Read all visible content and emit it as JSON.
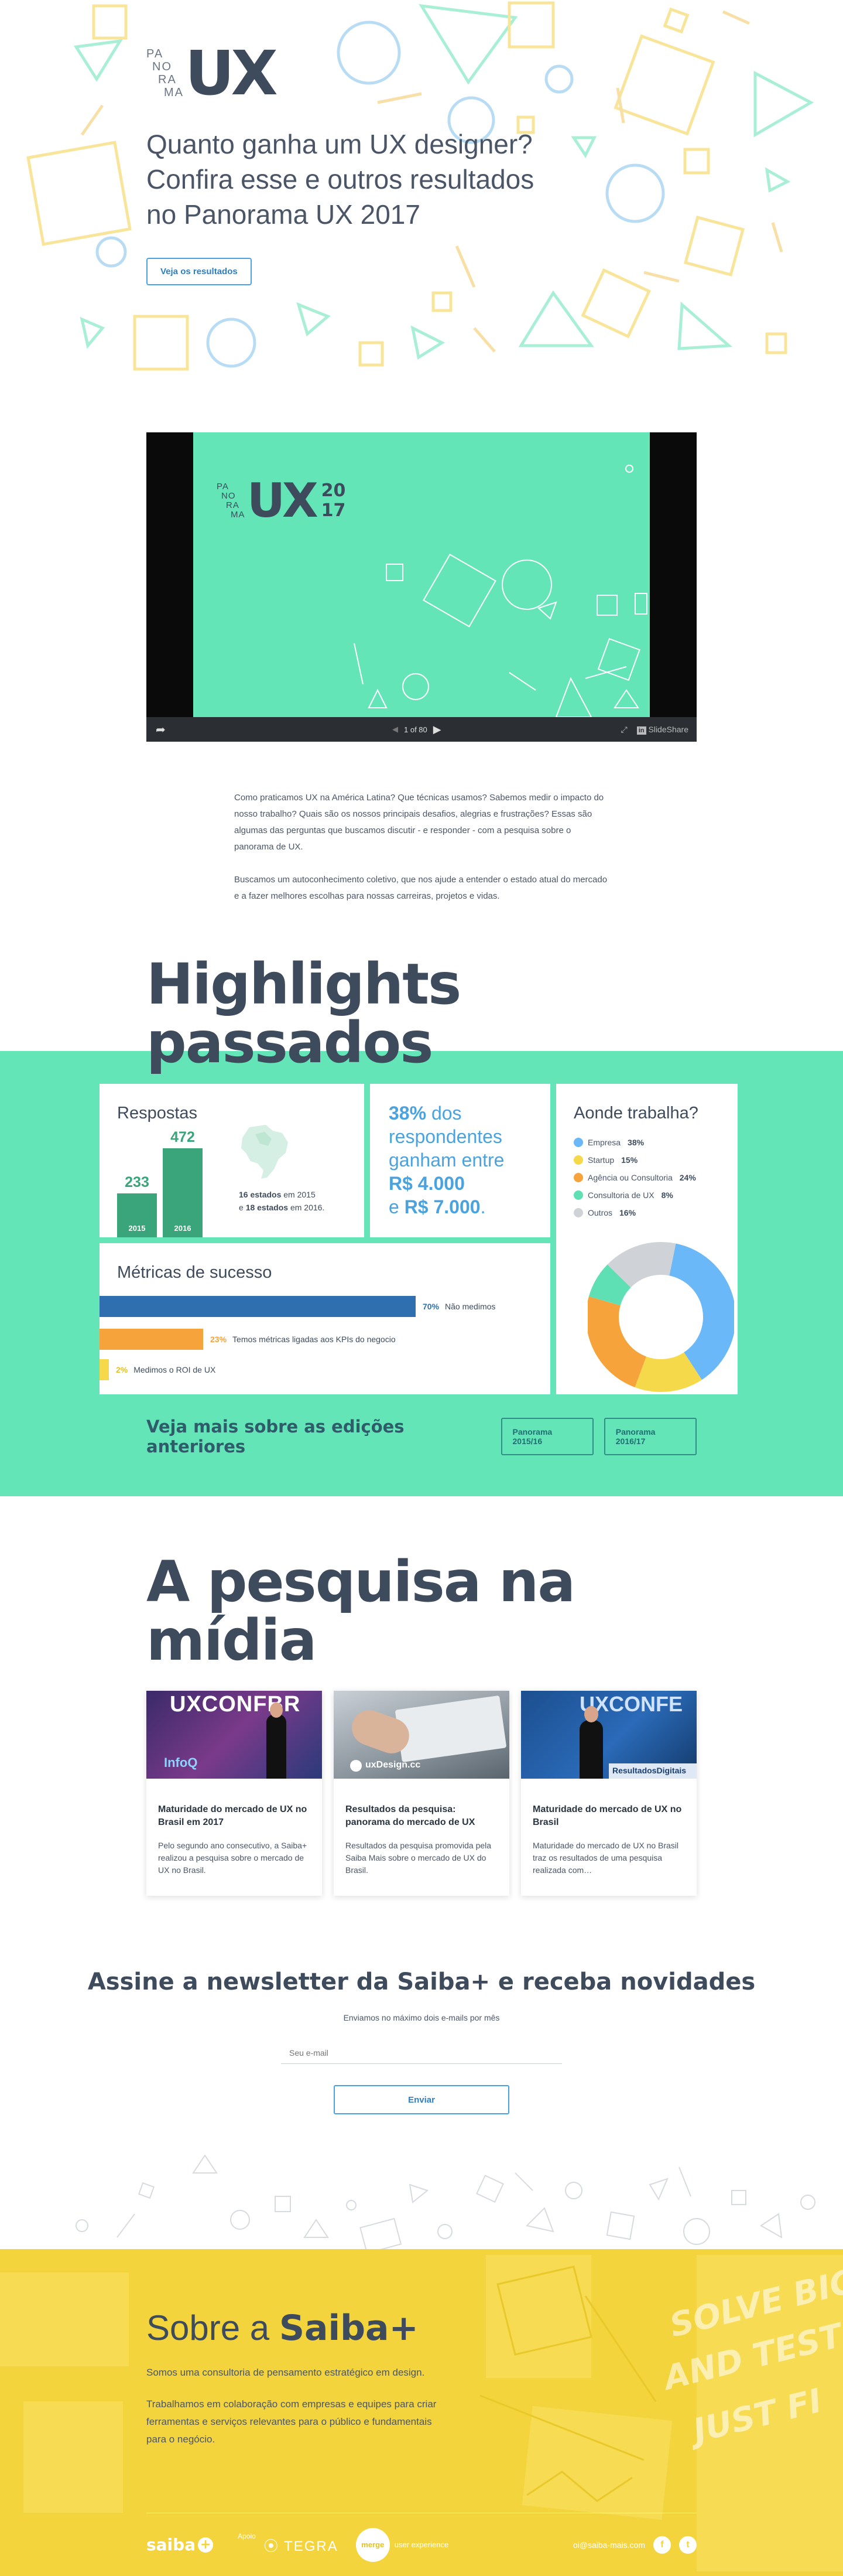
{
  "hero": {
    "logo_small": [
      "PA",
      "NO",
      "RA",
      "MA"
    ],
    "logo_big": "UX",
    "title": "Quanto ganha um UX designer? Confira esse e outros resultados no Panorama UX 2017",
    "button": "Veja os resultados"
  },
  "slide": {
    "logo_small": [
      "PA",
      "NO",
      "RA",
      "MA"
    ],
    "logo_big": "UX",
    "year_top": "20",
    "year_bottom": "17",
    "page_counter": "1 of 80",
    "brand": "SlideShare",
    "progress": 0.0125
  },
  "intro": {
    "p1": "Como praticamos UX na América Latina? Que técnicas usamos? Sabemos medir o impacto do nosso trabalho? Quais são os nossos principais desafios, alegrias e frustrações? Essas são algumas das perguntas que buscamos discutir - e responder - com a pesquisa sobre o panorama de UX.",
    "p2": "Buscamos um autoconhecimento coletivo, que nos ajude a entender o estado atual do mercado e a fazer melhores escolhas para nossas carreiras, projetos e vidas."
  },
  "highlights": {
    "title": "Highlights passados",
    "respostas": {
      "title": "Respostas",
      "bars": [
        {
          "year": "2015",
          "value": "233",
          "n": 233
        },
        {
          "year": "2016",
          "value": "472",
          "n": 472
        }
      ],
      "note_1a": "16 estados",
      "note_1b": " em 2015",
      "note_2a": "e ",
      "note_2b": "18 estados",
      "note_2c": " em 2016."
    },
    "pct": {
      "pct": "38%",
      "text1": " dos respondentes ganham entre ",
      "v1": "R$ 4.000",
      "text2": "e ",
      "v2": "R$ 7.000",
      "text3": "."
    },
    "onde": {
      "title": "Aonde trabalha?",
      "items": [
        {
          "label": "Empresa",
          "pct": "38%",
          "n": 38,
          "color": "#6ab8f7"
        },
        {
          "label": "Startup",
          "pct": "15%",
          "n": 15,
          "color": "#f6d94b"
        },
        {
          "label": "Agência ou Consultoria",
          "pct": "24%",
          "n": 24,
          "color": "#f5a33a"
        },
        {
          "label": "Consultoria de UX",
          "pct": "8%",
          "n": 8,
          "color": "#5fe0b4"
        },
        {
          "label": "Outros",
          "pct": "16%",
          "n": 16,
          "color": "#cfd3d8"
        }
      ]
    },
    "metricas": {
      "title": "Métricas de sucesso",
      "rows": [
        {
          "pct": "70%",
          "label": "Não medimos",
          "n": 70,
          "color": "#2f6fb0",
          "pct_color": "#2f6fb0"
        },
        {
          "pct": "23%",
          "label": "Temos métricas ligadas aos KPIs do negocio",
          "n": 23,
          "color": "#f5a33a",
          "pct_color": "#f5a33a"
        },
        {
          "pct": "2%",
          "label": "Medimos o ROI de UX",
          "n": 2,
          "color": "#f6d94b",
          "pct_color": "#e8c21c"
        }
      ]
    },
    "more_text": "Veja mais sobre as edições anteriores",
    "btn1": "Panorama 2015/16",
    "btn2": "Panorama 2016/17"
  },
  "media": {
    "title": "A pesquisa na mídia",
    "cards": [
      {
        "title": "Maturidade do mercado de UX no Brasil em 2017",
        "text": "Pelo segundo ano consecutivo, a Saiba+ realizou a pesquisa sobre o mercado de UX no Brasil.",
        "img_top": "UXCONFBR",
        "img_bottom": "InfoQ"
      },
      {
        "title": "Resultados da pesquisa: panorama do mercado de UX",
        "text": "Resultados da pesquisa promovida pela Saiba Mais sobre o mercado de UX do Brasil.",
        "img_top": "",
        "img_bottom": "uxDesign.cc"
      },
      {
        "title": "Maturidade do mercado de UX no Brasil",
        "text": "Maturidade do mercado de UX no Brasil traz os resultados de uma pesquisa realizada com…",
        "img_top": "UXCONFE",
        "img_bottom": "ResultadosDigitais"
      }
    ]
  },
  "newsletter": {
    "title": "Assine a newsletter da Saiba+ e receba novidades",
    "sub": "Enviamos no máximo dois e-mails por mês",
    "placeholder": "Seu e-mail",
    "button": "Enviar"
  },
  "about": {
    "title_a": "Sobre a ",
    "title_b": "Saiba+",
    "p1": "Somos uma consultoria de pensamento estratégico em design.",
    "p2": "Trabalhamos em colaboração com empresas e equipes para criar ferramentas e serviços relevantes para o público e fundamentais para o negócio.",
    "poster_words": [
      "SOLVE BIG PROB",
      "AND TEST NEW",
      "JUST FI"
    ]
  },
  "footer": {
    "logo": "saiba",
    "apoio": "Apoio",
    "tegra": "TEGRA",
    "merge": "merge",
    "merge_sub": "user experience",
    "email": "oi@saiba-mais.com",
    "fb": "f",
    "tw": "t"
  }
}
